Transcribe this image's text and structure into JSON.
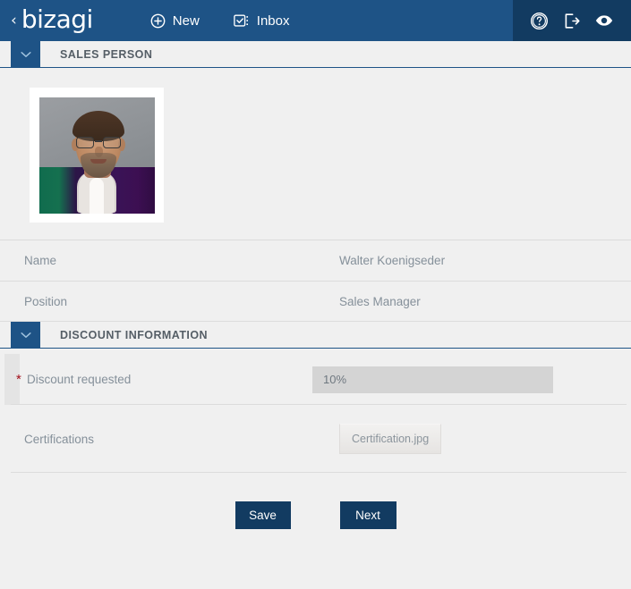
{
  "topbar": {
    "back_label": "‹",
    "logo": "bizagi",
    "nav": [
      {
        "label": "New",
        "icon": "plus-circle-icon"
      },
      {
        "label": "Inbox",
        "icon": "inbox-checkbox-icon"
      }
    ],
    "actions": [
      {
        "icon": "help-icon"
      },
      {
        "icon": "logout-icon"
      },
      {
        "icon": "eye-icon"
      }
    ],
    "colors": {
      "bar": "#1e5386",
      "bar_right": "#123b61"
    }
  },
  "sections": {
    "sales_person": {
      "title": "SALES PERSON",
      "toggle_icon": "chevron-down-icon"
    },
    "discount_information": {
      "title": "DISCOUNT INFORMATION",
      "toggle_icon": "chevron-down-icon"
    }
  },
  "photo": {
    "alt": "sales-person-photo"
  },
  "person_fields": [
    {
      "label": "Name",
      "value": "Walter Koenigseder"
    },
    {
      "label": "Position",
      "value": "Sales Manager"
    }
  ],
  "discount": {
    "required_marker": "*",
    "label": "Discount requested",
    "value": "10%",
    "placeholder": ""
  },
  "certifications": {
    "label": "Certifications",
    "file_name": "Certification.jpg"
  },
  "buttons": {
    "save_label": "Save",
    "next_label": "Next",
    "color": "#123b61"
  }
}
